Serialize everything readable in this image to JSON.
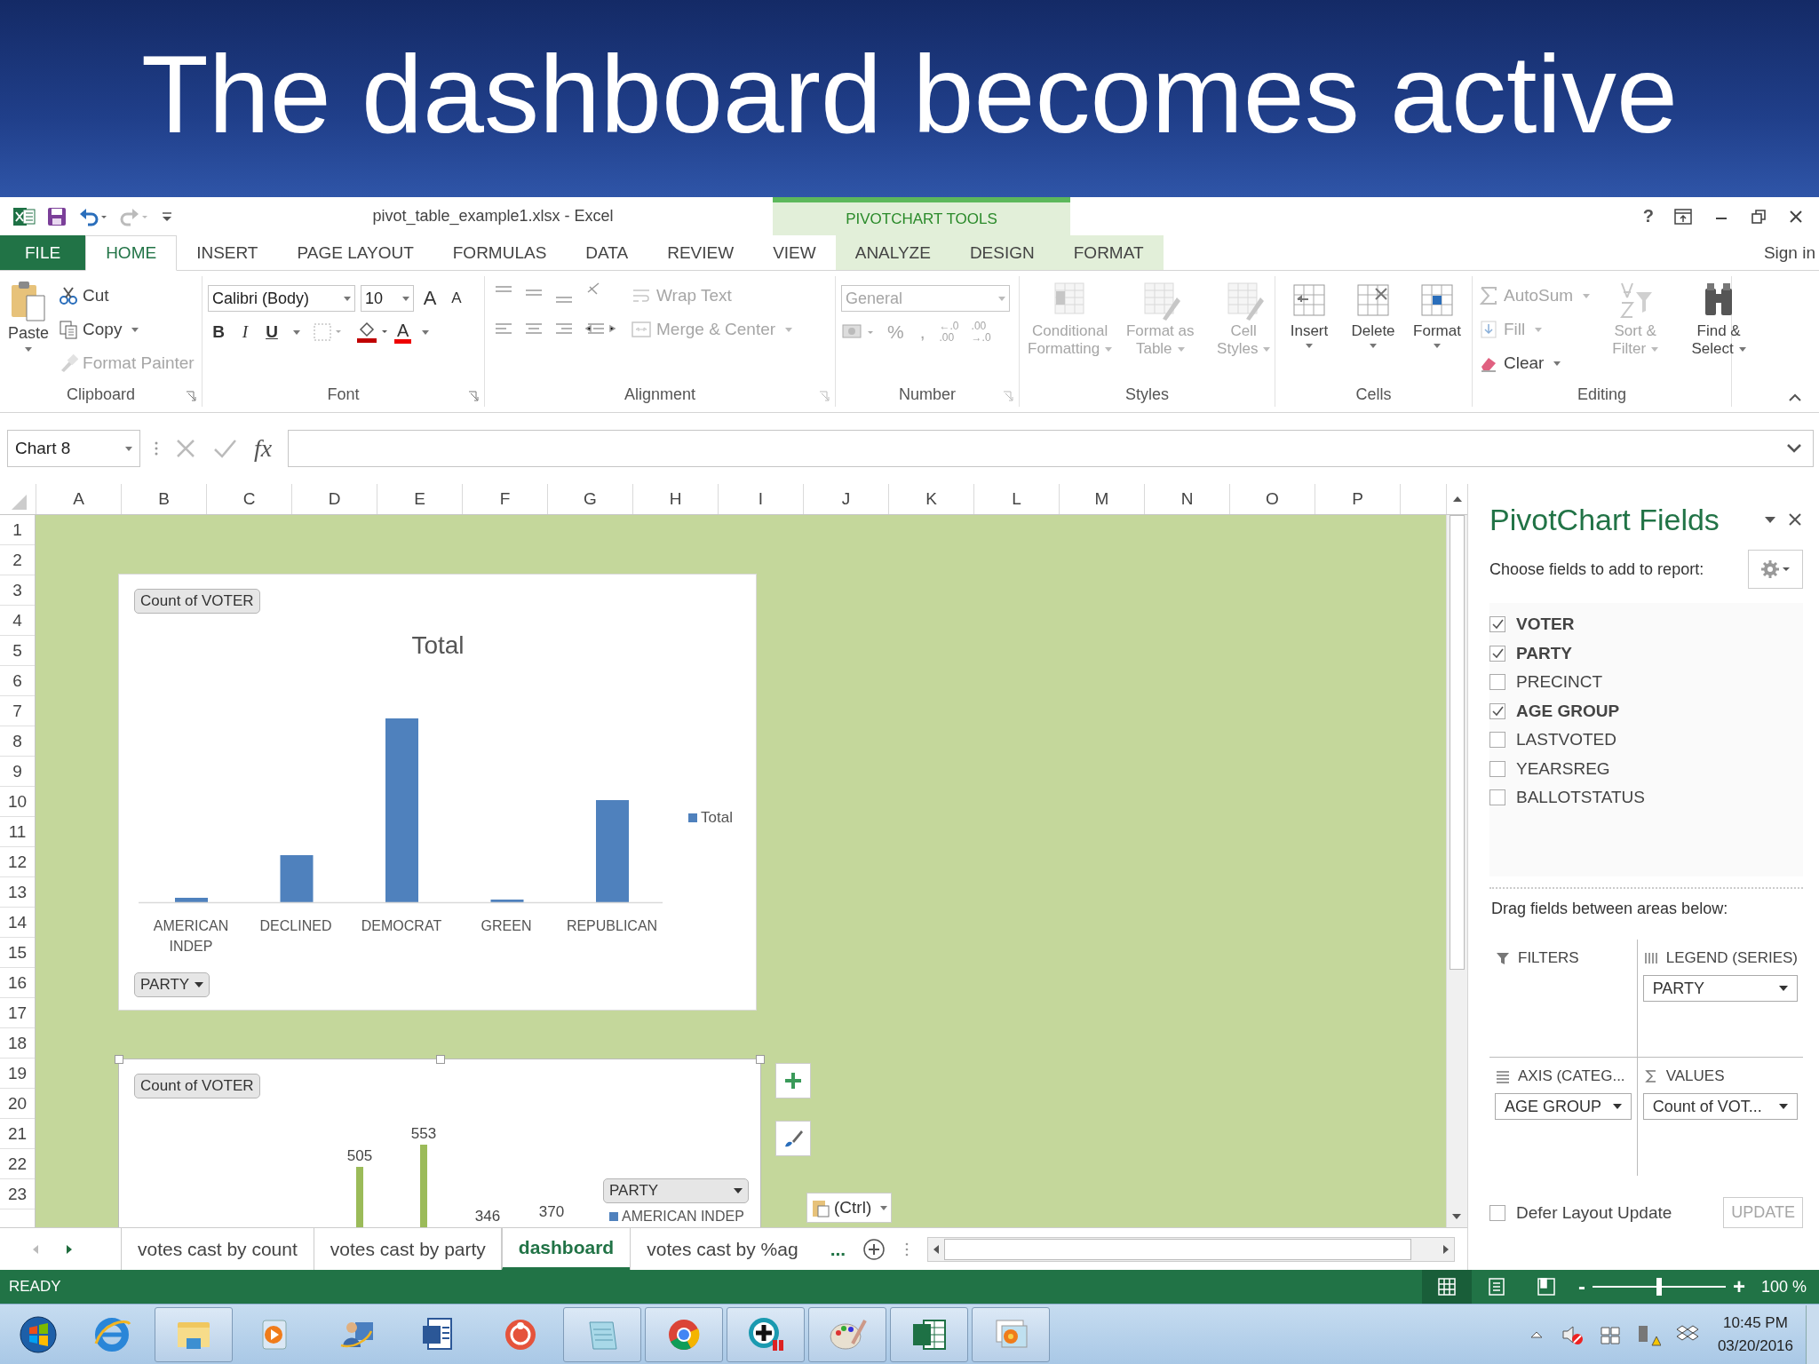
{
  "slide_title": "The dashboard becomes active",
  "window": {
    "title": "pivot_table_example1.xlsx - Excel",
    "context_group": "PIVOTCHART TOOLS",
    "help": "?",
    "sign_in": "Sign in"
  },
  "ribbon_tabs": [
    {
      "label": "FILE",
      "kind": "file",
      "selected": false
    },
    {
      "label": "HOME",
      "kind": "main",
      "selected": true
    },
    {
      "label": "INSERT",
      "kind": "main",
      "selected": false
    },
    {
      "label": "PAGE LAYOUT",
      "kind": "main",
      "selected": false
    },
    {
      "label": "FORMULAS",
      "kind": "main",
      "selected": false
    },
    {
      "label": "DATA",
      "kind": "main",
      "selected": false
    },
    {
      "label": "REVIEW",
      "kind": "main",
      "selected": false
    },
    {
      "label": "VIEW",
      "kind": "main",
      "selected": false
    },
    {
      "label": "ANALYZE",
      "kind": "context",
      "selected": false
    },
    {
      "label": "DESIGN",
      "kind": "context",
      "selected": false
    },
    {
      "label": "FORMAT",
      "kind": "context",
      "selected": false
    }
  ],
  "ribbon_groups": [
    {
      "label": "Clipboard",
      "buttons": [
        {
          "label": "Paste",
          "disabled": false
        },
        {
          "label": "Cut",
          "disabled": false
        },
        {
          "label": "Copy",
          "disabled": false
        },
        {
          "label": "Format Painter",
          "disabled": true
        }
      ]
    },
    {
      "label": "Font",
      "font_name": "Calibri (Body)",
      "font_size": "10",
      "buttons": [
        {
          "label": "A",
          "kind": "grow"
        },
        {
          "label": "A",
          "kind": "shrink"
        },
        {
          "label": "B",
          "kind": "bold"
        },
        {
          "label": "I",
          "kind": "italic"
        },
        {
          "label": "U",
          "kind": "underline"
        },
        {
          "label": "A",
          "kind": "font_color"
        }
      ]
    },
    {
      "label": "Alignment",
      "buttons": [
        {
          "label": "Wrap Text",
          "disabled": true
        },
        {
          "label": "Merge & Center",
          "disabled": true
        }
      ]
    },
    {
      "label": "Number",
      "format": "General",
      "buttons": [
        {
          "label": "%",
          "disabled": true
        },
        {
          "label": ",",
          "disabled": true
        },
        {
          "label": "←.0",
          "line2": ".00",
          "disabled": true
        },
        {
          "label": ".00",
          "line2": "→.0",
          "disabled": true
        }
      ]
    },
    {
      "label": "Styles",
      "buttons": [
        {
          "label": "Conditional",
          "line2": "Formatting",
          "disabled": true
        },
        {
          "label": "Format as",
          "line2": "Table",
          "disabled": true
        },
        {
          "label": "Cell",
          "line2": "Styles",
          "disabled": true
        }
      ]
    },
    {
      "label": "Cells",
      "buttons": [
        {
          "label": "Insert",
          "disabled": false
        },
        {
          "label": "Delete",
          "disabled": false
        },
        {
          "label": "Format",
          "disabled": false
        }
      ]
    },
    {
      "label": "Editing",
      "buttons": [
        {
          "label": "AutoSum",
          "disabled": true
        },
        {
          "label": "Fill",
          "disabled": true
        },
        {
          "label": "Clear",
          "disabled": false
        },
        {
          "label": "Sort &",
          "line2": "Filter",
          "disabled": true
        },
        {
          "label": "Find &",
          "line2": "Select",
          "disabled": false
        }
      ]
    }
  ],
  "formula_bar": {
    "name_box": "Chart 8",
    "fx": "fx"
  },
  "columns": [
    "A",
    "B",
    "C",
    "D",
    "E",
    "F",
    "G",
    "H",
    "I",
    "J",
    "K",
    "L",
    "M",
    "N",
    "O",
    "P"
  ],
  "rows": [
    "1",
    "2",
    "3",
    "4",
    "5",
    "6",
    "7",
    "8",
    "9",
    "10",
    "11",
    "12",
    "13",
    "14",
    "15",
    "16",
    "17",
    "18",
    "19",
    "20",
    "21",
    "22",
    "23"
  ],
  "chart_1": {
    "field_button": "Count of VOTER",
    "title": "Total",
    "categories": [
      "AMERICAN INDEP",
      "DECLINED",
      "DEMOCRAT",
      "GREEN",
      "REPUBLICAN"
    ],
    "legend": "Total",
    "axis_field": "PARTY"
  },
  "chart_2": {
    "field_button": "Count of VOTER",
    "data_labels": [
      "505",
      "553",
      "346",
      "370"
    ],
    "legend_field": "PARTY",
    "legend_entry": "AMERICAN INDEP",
    "selected": true
  },
  "paste_options": "(Ctrl)",
  "sheet_tabs": [
    {
      "label": "votes cast by count",
      "selected": false
    },
    {
      "label": "votes cast by party",
      "selected": false
    },
    {
      "label": "dashboard",
      "selected": true
    },
    {
      "label": "votes cast by %ag",
      "selected": false
    }
  ],
  "sheet_more": "...",
  "status_bar": {
    "mode": "READY",
    "views": [
      {
        "selected": true
      },
      {
        "selected": false
      },
      {
        "selected": false
      }
    ],
    "zoom": {
      "minus": "-",
      "plus": "+",
      "level": 0.5,
      "reading": "100 %"
    }
  },
  "pivot_pane": {
    "title": "PivotChart Fields",
    "subtitle": "Choose fields to add to report:",
    "fields": [
      {
        "label": "VOTER",
        "checked": true
      },
      {
        "label": "PARTY",
        "checked": true
      },
      {
        "label": "PRECINCT",
        "checked": false
      },
      {
        "label": "AGE GROUP",
        "checked": true
      },
      {
        "label": "LASTVOTED",
        "checked": false
      },
      {
        "label": "YEARSREG",
        "checked": false
      },
      {
        "label": "BALLOTSTATUS",
        "checked": false
      }
    ],
    "drag_hint": "Drag fields between areas below:",
    "areas": [
      {
        "label": "FILTERS",
        "kind": "filters"
      },
      {
        "label": "LEGEND (SERIES)",
        "kind": "legend",
        "items": [
          "PARTY"
        ]
      },
      {
        "label": "AXIS (CATEG...",
        "kind": "axis",
        "items": [
          "AGE GROUP"
        ]
      },
      {
        "label": "VALUES",
        "kind": "values",
        "items": [
          "Count of VOT..."
        ]
      }
    ],
    "defer": {
      "label": "Defer Layout Update",
      "checked": false
    },
    "update": {
      "label": "UPDATE",
      "disabled": true
    }
  },
  "taskbar": {
    "apps": [
      {
        "kind": "ie",
        "running": false
      },
      {
        "kind": "explorer",
        "running": true
      },
      {
        "kind": "media",
        "running": false
      },
      {
        "kind": "user",
        "running": false
      },
      {
        "kind": "word",
        "running": false
      },
      {
        "kind": "ring",
        "running": false
      },
      {
        "kind": "notepad",
        "running": true
      },
      {
        "kind": "chrome",
        "running": true
      },
      {
        "kind": "plus",
        "running": true
      },
      {
        "kind": "paint",
        "running": true
      },
      {
        "kind": "excel",
        "running": true
      },
      {
        "kind": "photos",
        "running": true
      }
    ],
    "time": "10:45 PM",
    "date": "03/20/2016"
  }
}
